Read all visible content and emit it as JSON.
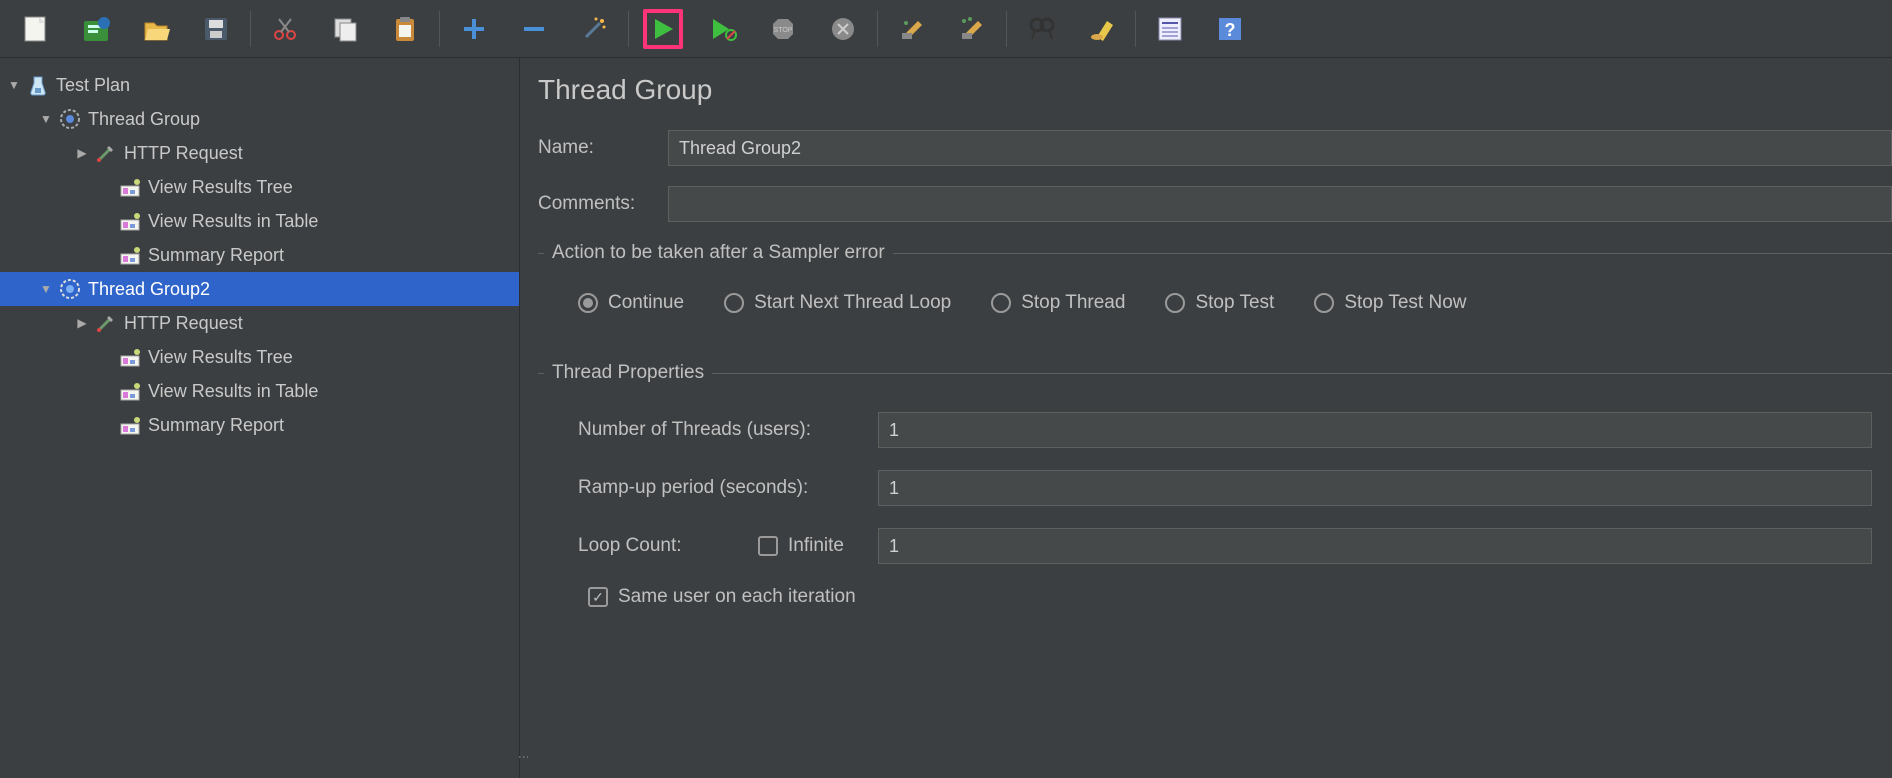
{
  "tree": {
    "root": "Test Plan",
    "tg1": "Thread Group",
    "tg1_http": "HTTP Request",
    "tg1_vrt": "View Results Tree",
    "tg1_vrit": "View Results in Table",
    "tg1_sum": "Summary Report",
    "tg2": "Thread Group2",
    "tg2_http": "HTTP Request",
    "tg2_vrt": "View Results Tree",
    "tg2_vrit": "View Results in Table",
    "tg2_sum": "Summary Report"
  },
  "panel": {
    "title": "Thread Group",
    "name_label": "Name:",
    "name_value": "Thread Group2",
    "comments_label": "Comments:",
    "comments_value": "",
    "error_legend": "Action to be taken after a Sampler error",
    "radio_continue": "Continue",
    "radio_next": "Start Next Thread Loop",
    "radio_stop_thread": "Stop Thread",
    "radio_stop_test": "Stop Test",
    "radio_stop_now": "Stop Test Now",
    "props_legend": "Thread Properties",
    "threads_label": "Number of Threads (users):",
    "threads_value": "1",
    "ramp_label": "Ramp-up period (seconds):",
    "ramp_value": "1",
    "loop_label": "Loop Count:",
    "loop_infinite": "Infinite",
    "loop_value": "1",
    "same_user": "Same user on each iteration"
  },
  "colors": {
    "highlight": "#ff3377",
    "selection": "#2f65ca"
  }
}
